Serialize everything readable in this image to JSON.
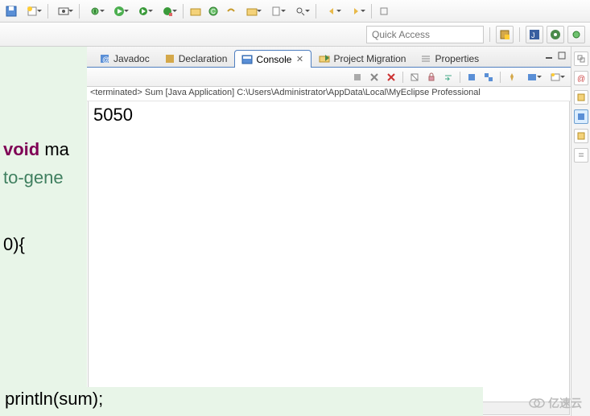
{
  "quick_access": {
    "placeholder": "Quick Access"
  },
  "tabs": {
    "javadoc": "Javadoc",
    "declaration": "Declaration",
    "console": "Console",
    "project_migration": "Project Migration",
    "properties": "Properties"
  },
  "console": {
    "terminated": "<terminated> Sum [Java Application] C:\\Users\\Administrator\\AppData\\Local\\MyEclipse Professional",
    "output": "5050"
  },
  "editor_fragments": {
    "void": "void",
    "ma": " ma",
    "togene": "to-gene",
    "brace": "0){",
    "println": "println(sum);"
  },
  "watermark": "亿速云"
}
